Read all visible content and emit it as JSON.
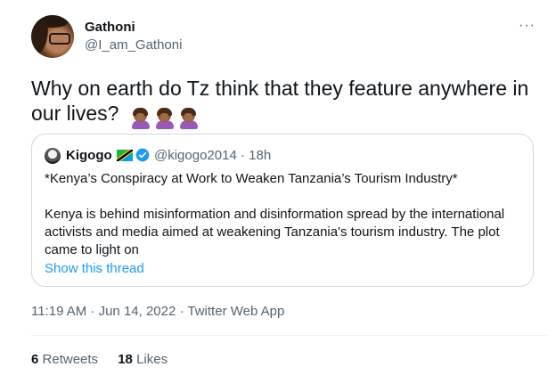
{
  "author": {
    "name": "Gathoni",
    "handle": "@I_am_Gathoni"
  },
  "more_icon": "more-horizontal-icon",
  "tweet": {
    "text": "Why on earth do Tz think that they feature anywhere in our lives?",
    "emojis": [
      "woman-facepalming-medium-dark",
      "woman-facepalming-medium-dark",
      "woman-facepalming-medium-dark"
    ]
  },
  "quoted": {
    "name": "Kigogo",
    "flag": "tanzania-flag-icon",
    "verified_icon": "verified-badge-icon",
    "meta": "@kigogo2014 · 18h",
    "headline": "*Kenya’s Conspiracy at Work to Weaken Tanzania’s Tourism Industry*",
    "body": "Kenya is behind misinformation and disinformation spread by the international activists and media aimed at weakening Tanzania's tourism industry. The plot came to light on",
    "show_thread": "Show this thread"
  },
  "timestamp": "11:19 AM · Jun 14, 2022 · Twitter Web App",
  "stats": {
    "retweets_count": "6",
    "retweets_label": "Retweets",
    "likes_count": "18",
    "likes_label": "Likes"
  },
  "colors": {
    "text": "#0f1419",
    "secondary": "#536471",
    "link": "#1d9bf0",
    "border": "#cfd9de"
  }
}
